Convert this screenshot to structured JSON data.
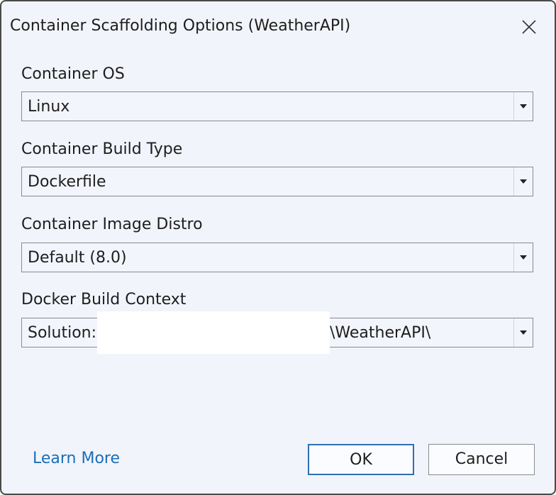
{
  "window": {
    "title": "Container Scaffolding Options (WeatherAPI)"
  },
  "fields": {
    "container_os": {
      "label": "Container OS",
      "value": "Linux"
    },
    "build_type": {
      "label": "Container Build Type",
      "value": "Dockerfile"
    },
    "image_distro": {
      "label": "Container Image Distro",
      "value": "Default (8.0)"
    },
    "build_context": {
      "label": "Docker Build Context",
      "prefix": "Solution:",
      "suffix": "\\WeatherAPI\\"
    }
  },
  "footer": {
    "learn_more": "Learn More",
    "ok_label": "OK",
    "cancel_label": "Cancel"
  },
  "icons": {
    "close": "close-icon",
    "dropdown": "chevron-down-icon"
  },
  "colors": {
    "link": "#1a6fb8",
    "default_button_border": "#2f6fb0",
    "dialog_background": "#f2f4fb"
  }
}
